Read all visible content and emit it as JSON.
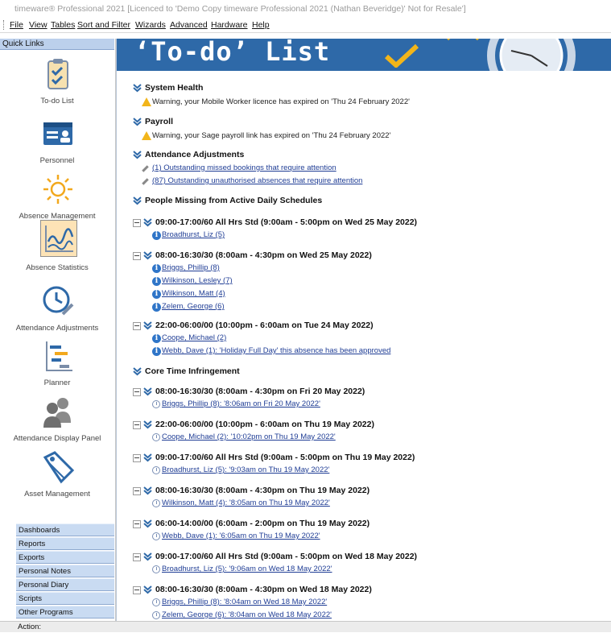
{
  "window": {
    "title": "timeware® Professional 2021 [Licenced to 'Demo Copy timeware Professional 2021 (Nathan Beveridge)' Not for Resale']"
  },
  "menu": [
    "File",
    "View",
    "Tables",
    "Sort and Filter",
    "Wizards",
    "Advanced",
    "Hardware",
    "Help"
  ],
  "sidebar": {
    "header": "Quick Links",
    "items": [
      {
        "label": "To-do List",
        "icon": "clipboard-checklist-icon"
      },
      {
        "label": "Personnel",
        "icon": "id-card-icon"
      },
      {
        "label": "Absence Management",
        "icon": "sun-icon"
      },
      {
        "label": "Absence Statistics",
        "icon": "chart-icon",
        "selected": true
      },
      {
        "label": "Attendance Adjustments",
        "icon": "clock-pencil-icon"
      },
      {
        "label": "Planner",
        "icon": "gantt-icon"
      },
      {
        "label": "Attendance Display Panel",
        "icon": "people-icon"
      },
      {
        "label": "Asset Management",
        "icon": "tag-icon"
      }
    ],
    "nav": [
      "Dashboards",
      "Reports",
      "Exports",
      "Personal Notes",
      "Personal Diary",
      "Scripts",
      "Other Programs"
    ]
  },
  "status": {
    "label": "Action:"
  },
  "banner": {
    "title": "‘To-do’ List"
  },
  "sections": {
    "system_health": {
      "heading": "System Health",
      "warning": "Warning, your Mobile Worker licence has expired on 'Thu 24 February 2022'"
    },
    "payroll": {
      "heading": "Payroll",
      "warning": "Warning, your Sage payroll link has expired on 'Thu 24 February 2022'"
    },
    "attendance_adjustments": {
      "heading": "Attendance Adjustments",
      "links": [
        "(1) Outstanding missed bookings that require attention",
        "(87) Outstanding unauthorised absences that require attention"
      ]
    },
    "people_missing": {
      "heading": "People Missing from Active Daily Schedules",
      "groups": [
        {
          "title": "09:00-17:00/60 All Hrs Std (9:00am - 5:00pm on Wed 25 May 2022)",
          "people": [
            "Broadhurst, Liz (5)"
          ]
        },
        {
          "title": "08:00-16:30/30 (8:00am - 4:30pm on Wed 25 May 2022)",
          "people": [
            "Briggs, Phillip (8)",
            "Wilkinson, Lesley (7)",
            "Wilkinson, Matt (4)",
            "Zelem, George (6)"
          ]
        },
        {
          "title": "22:00-06:00/00 (10:00pm - 6:00am on Tue 24 May 2022)",
          "people": [
            "Coope, Michael (2)",
            "Webb, Dave (1): 'Holiday Full Day' this absence has been approved"
          ]
        }
      ]
    },
    "core_time": {
      "heading": "Core Time Infringement",
      "groups": [
        {
          "title": "08:00-16:30/30 (8:00am - 4:30pm on Fri 20 May 2022)",
          "items": [
            "Briggs, Phillip (8): '8:06am on Fri 20 May 2022'"
          ]
        },
        {
          "title": "22:00-06:00/00 (10:00pm - 6:00am on Thu 19 May 2022)",
          "items": [
            "Coope, Michael (2): '10:02pm on Thu 19 May 2022'"
          ]
        },
        {
          "title": "09:00-17:00/60 All Hrs Std (9:00am - 5:00pm on Thu 19 May 2022)",
          "items": [
            "Broadhurst, Liz (5): '9:03am on Thu 19 May 2022'"
          ]
        },
        {
          "title": "08:00-16:30/30 (8:00am - 4:30pm on Thu 19 May 2022)",
          "items": [
            "Wilkinson, Matt (4): '8:05am on Thu 19 May 2022'"
          ]
        },
        {
          "title": "06:00-14:00/00 (6:00am - 2:00pm on Thu 19 May 2022)",
          "items": [
            "Webb, Dave (1): '6:05am on Thu 19 May 2022'"
          ]
        },
        {
          "title": "09:00-17:00/60 All Hrs Std (9:00am - 5:00pm on Wed 18 May 2022)",
          "items": [
            "Broadhurst, Liz (5): '9:06am on Wed 18 May 2022'"
          ]
        },
        {
          "title": "08:00-16:30/30 (8:00am - 4:30pm on Wed 18 May 2022)",
          "items": [
            "Briggs, Phillip (8): '8:04am on Wed 18 May 2022'",
            "Zelem, George (6): '8:04am on Wed 18 May 2022'"
          ]
        }
      ]
    }
  },
  "colors": {
    "banner": "#2e69a8",
    "link": "#1f3d95",
    "sidebar_nav": "#c9dbf2",
    "selected_item": "#fde3b6"
  }
}
